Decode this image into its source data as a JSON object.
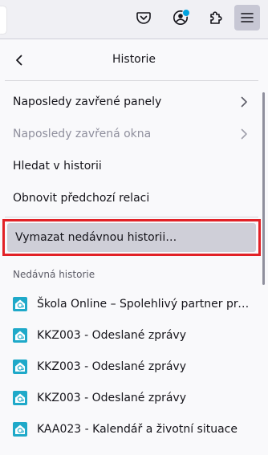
{
  "toolbar": {
    "buttons": [
      {
        "name": "pocket-button",
        "icon": "pocket-icon"
      },
      {
        "name": "account-button",
        "icon": "account-icon"
      },
      {
        "name": "extensions-button",
        "icon": "puzzle-icon"
      },
      {
        "name": "app-menu-button",
        "icon": "hamburger-menu-icon",
        "active": true
      }
    ]
  },
  "panel": {
    "title": "Historie",
    "back_icon": "chevron-left-icon",
    "items": [
      {
        "label": "Naposledy zavřené panely",
        "has_submenu": true,
        "disabled": false
      },
      {
        "label": "Naposledy zavřená okna",
        "has_submenu": true,
        "disabled": true
      },
      {
        "label": "Hledat v historii",
        "has_submenu": false,
        "disabled": false
      },
      {
        "label": "Obnovit předchozí relaci",
        "has_submenu": false,
        "disabled": false
      }
    ],
    "clear_history": {
      "label": "Vymazat nedávnou historii…",
      "highlight_color": "#e22126"
    },
    "recent_title": "Nedávná historie",
    "recent": [
      {
        "label": "Škola Online – Spolehlivý partner pro š…",
        "favicon": "school-online-icon"
      },
      {
        "label": "KKZ003 - Odeslané zprávy",
        "favicon": "school-online-icon"
      },
      {
        "label": "KKZ003 - Odeslané zprávy",
        "favicon": "school-online-icon"
      },
      {
        "label": "KKZ003 - Odeslané zprávy",
        "favicon": "school-online-icon"
      },
      {
        "label": "KAA023 - Kalendář a životní situace",
        "favicon": "school-online-icon"
      }
    ]
  },
  "colors": {
    "accent": "#00a3e0",
    "favicon": "#1fa9c9",
    "highlight": "#e22126"
  }
}
